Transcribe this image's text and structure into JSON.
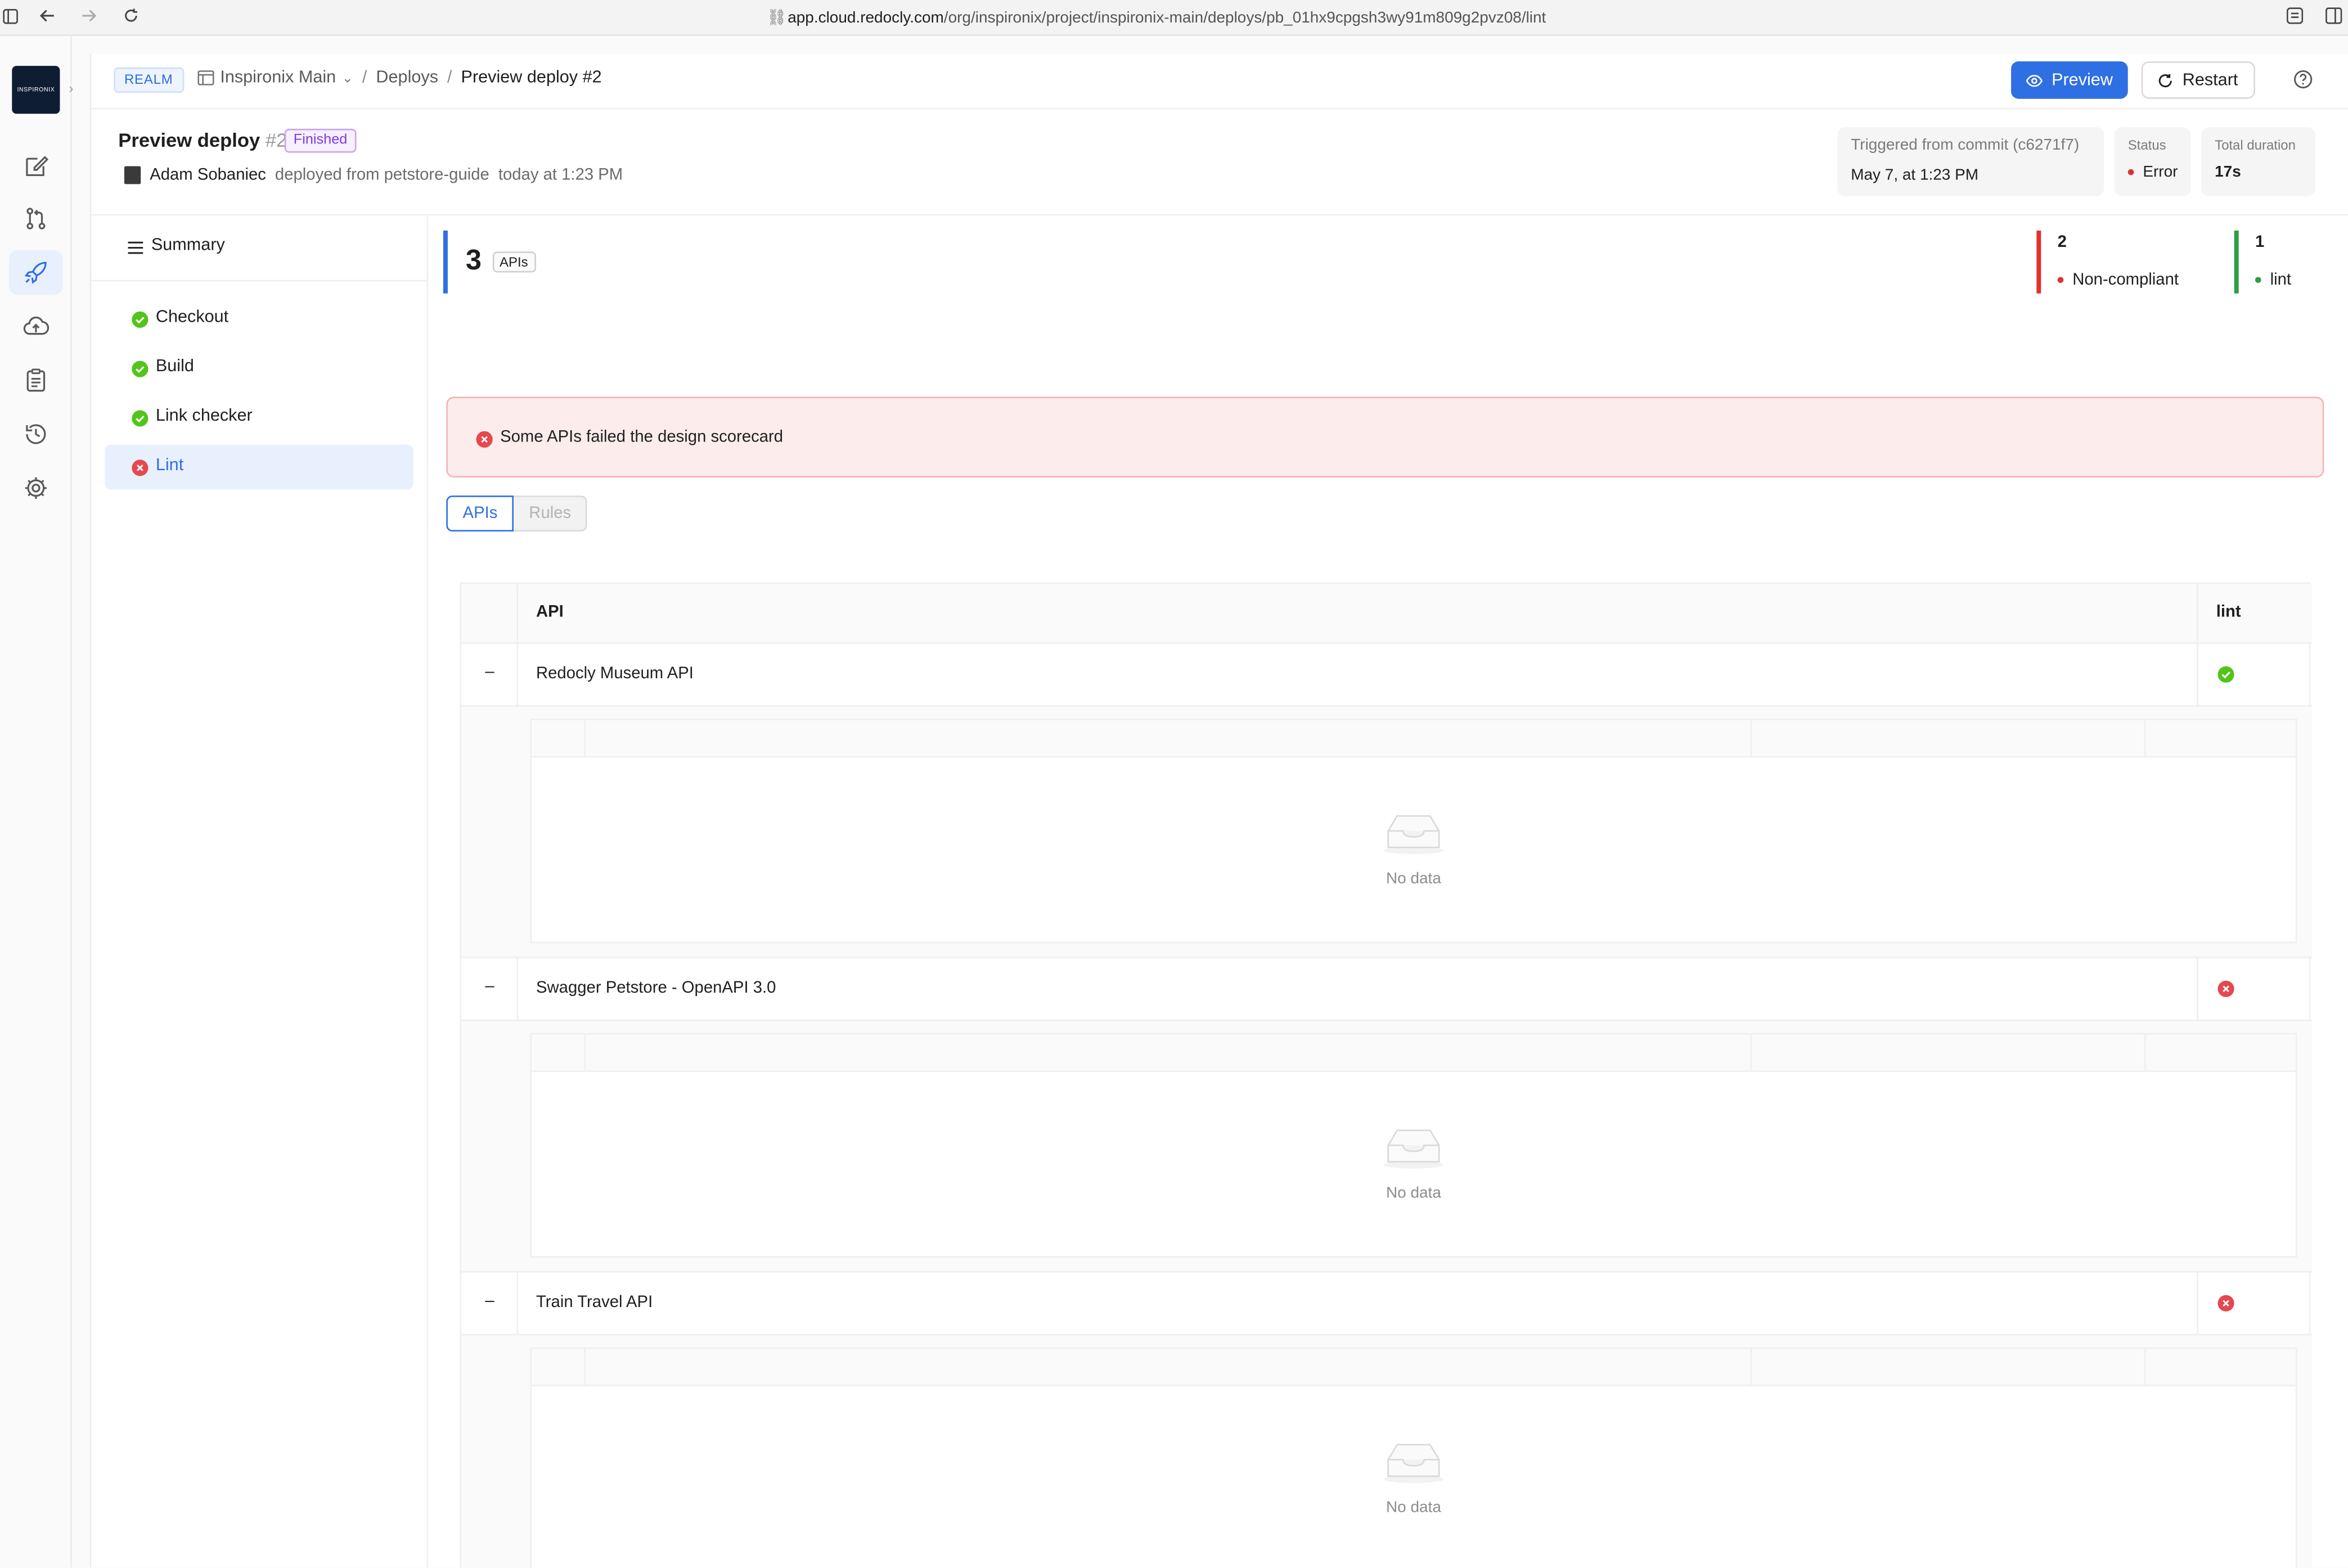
{
  "browser": {
    "url_host": "app.cloud.redocly.com",
    "url_path": "/org/inspironix/project/inspironix-main/deploys/pb_01hx9cpgsh3wy91m809g2pvz08/lint"
  },
  "rail": {
    "logo_text": "INSPIRONIX",
    "items": [
      "edit-icon",
      "pull-request-icon",
      "rocket-icon",
      "cloud-icon",
      "clipboard-icon",
      "history-icon",
      "settings-icon"
    ]
  },
  "topbar": {
    "realm": "REALM",
    "project": "Inspironix Main",
    "crumb_deploys": "Deploys",
    "crumb_current": "Preview deploy #2",
    "preview_label": "Preview",
    "restart_label": "Restart"
  },
  "deploy": {
    "title": "Preview deploy",
    "number": "#2",
    "badge": "Finished",
    "author": "Adam Sobaniec",
    "source": "deployed from petstore-guide",
    "time": "today at 1:23 PM",
    "trigger_label": "Triggered from commit (c6271f7)",
    "trigger_value": "May 7, at 1:23 PM",
    "status_label": "Status",
    "status_value": "Error",
    "duration_label": "Total duration",
    "duration_value": "17s"
  },
  "steps": {
    "summary_label": "Summary",
    "items": [
      {
        "label": "Checkout",
        "state": "success"
      },
      {
        "label": "Build",
        "state": "success"
      },
      {
        "label": "Link checker",
        "state": "success"
      },
      {
        "label": "Lint",
        "state": "error"
      }
    ]
  },
  "content": {
    "apis_count": "3",
    "apis_tag": "APIs",
    "stat_noncompliant_num": "2",
    "stat_noncompliant_label": "Non-compliant",
    "stat_lint_num": "1",
    "stat_lint_label": "lint",
    "alert_text": "Some APIs failed the design scorecard",
    "tab_apis": "APIs",
    "tab_rules": "Rules",
    "col_api": "API",
    "col_lint": "lint",
    "toggle_symbol": "–",
    "no_data": "No data",
    "rows": [
      {
        "name": "Redocly Museum API",
        "lint": "success"
      },
      {
        "name": "Swagger Petstore - OpenAPI 3.0",
        "lint": "error"
      },
      {
        "name": "Train Travel API",
        "lint": "error"
      }
    ]
  },
  "colors": {
    "accent": "#2f6fe4",
    "success": "#52c41a",
    "error": "#e5484d",
    "error_bg": "#fdecec"
  }
}
